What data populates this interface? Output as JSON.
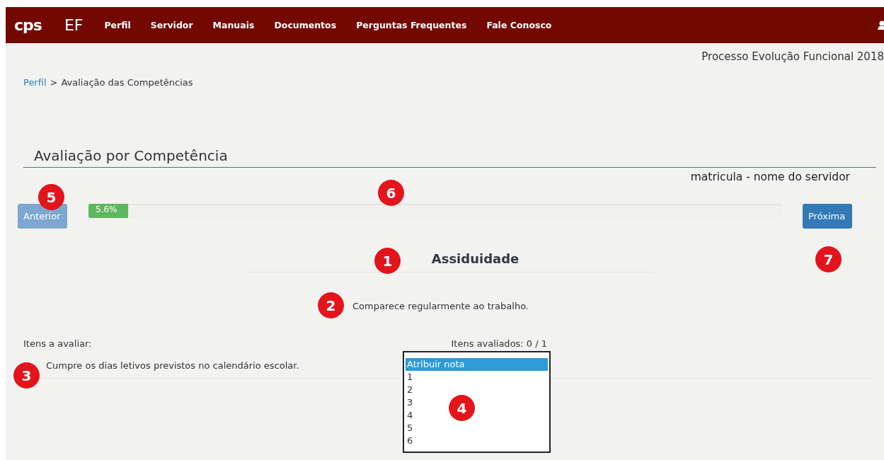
{
  "navbar": {
    "logo": "cps",
    "app": "EF",
    "items": [
      "Perfil",
      "Servidor",
      "Manuais",
      "Documentos",
      "Perguntas Frequentes",
      "Fale Conosco"
    ]
  },
  "process_title": "Processo Evolução Funcional 2018",
  "breadcrumb": {
    "link": "Perfil",
    "separator": ">",
    "current": "Avaliação das Competências"
  },
  "heading": "Avaliação por Competência",
  "employee": "matricula - nome do servidor",
  "prev_button": {
    "label": "Anterior",
    "disabled": true
  },
  "progress": {
    "level": 0.056,
    "label": "5.6%"
  },
  "next_button": {
    "label": "Próxima",
    "disabled": false
  },
  "competence": "Assiduidade",
  "description": "Comparece regularmente ao trabalho.",
  "items_label": "Itens a avaliar:",
  "items_count": "Itens avaliados: 0 / 1",
  "items": [
    {
      "text": "Cumpre os dias letivos previstos no calendário escolar."
    }
  ],
  "grade_options": [
    {
      "label": "Atribuir nota",
      "selected": true
    },
    {
      "label": "1",
      "selected": false
    },
    {
      "label": "2",
      "selected": false
    },
    {
      "label": "3",
      "selected": false
    },
    {
      "label": "4",
      "selected": false
    },
    {
      "label": "5",
      "selected": false
    },
    {
      "label": "6",
      "selected": false
    }
  ],
  "callouts": [
    "1",
    "2",
    "3",
    "4",
    "5",
    "6",
    "7"
  ]
}
